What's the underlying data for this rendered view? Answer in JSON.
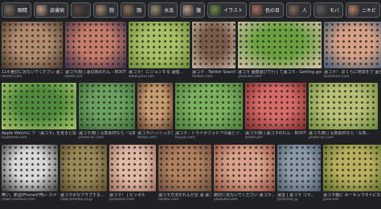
{
  "chips": [
    {
      "label": "眼睛",
      "color": "#7a6a5a"
    },
    {
      "label": "皮膚病",
      "color": "#b99a86"
    },
    {
      "label": "",
      "color": "#5b4a3f"
    },
    {
      "label": "腕",
      "color": "#a08872"
    },
    {
      "label": "顔",
      "color": "#8e6f5c"
    },
    {
      "label": "水虫",
      "color": "#9a8a6a"
    },
    {
      "label": "腹",
      "color": "#b89b8a"
    },
    {
      "label": "イラスト",
      "color": "#6a8a4a"
    },
    {
      "label": "色の目",
      "color": "#aa7060"
    },
    {
      "label": "人",
      "color": "#7b6b5b"
    },
    {
      "label": "モバ",
      "color": "#5a5a5a"
    },
    {
      "label": "ニキビ",
      "color": "#b07f6a"
    },
    {
      "label": "カエル",
      "color": "#6a7a4a"
    }
  ],
  "row1": [
    {
      "caption": "114 絶対に見ないでください 蓮コラ！",
      "source": "twitter.com",
      "colors": [
        "#b28b6f",
        "#4a3a30"
      ]
    },
    {
      "caption": "蓮コラ/顔 | 蓮の顔のれん - BOOTH",
      "source": "booth.pm",
      "colors": [
        "#c77b6b",
        "#3a2c4a"
      ]
    },
    {
      "caption": "蓮コラ！ にジョンする 蓮陸…",
      "source": "www.pixiv.net",
      "colors": [
        "#a8c067",
        "#6d8a3a"
      ]
    },
    {
      "caption": "蓮コラ - Twitter Search…",
      "source": "twitter.com",
      "colors": [
        "#7a5a4a",
        "#c9b8a8"
      ]
    },
    {
      "caption": "蓮コラ 画像遊びで行くて蓮コラ - Getting goos…",
      "source": "youtube.com",
      "colors": [
        "#6aa040",
        "#d9c2b0"
      ]
    },
    {
      "caption": "蓮コラ！ ぼくらに地球をで 蓮がない…",
      "source": "buzzfeed.com",
      "colors": [
        "#d6a086",
        "#3f5a7a"
      ]
    }
  ],
  "row2": [
    {
      "caption": "Apple Watchに ケ「蓮コラ」を見ると思い…",
      "source": "buzzfeed.com",
      "colors": [
        "#4d8a3d",
        "#a8c46a"
      ]
    },
    {
      "caption": "蓮コラ/顔 | 写真素材なら「写真…",
      "source": "photo-ac.com",
      "colors": [
        "#6aa060",
        "#3d6a3a"
      ]
    },
    {
      "caption": "蓮コラ/ハッシュタグな…",
      "source": "tiktok.com",
      "colors": [
        "#c89a72",
        "#5a3a2a"
      ]
    },
    {
      "caption": "蓮コラ - トライポフォビアの蓮とジ…",
      "source": "tsuyoi.com",
      "colors": [
        "#7ab060",
        "#4a7a3a"
      ]
    },
    {
      "caption": "蓮コラ/顔 | 蓮コラのれん - BOOTH",
      "source": "booth.pm",
      "colors": [
        "#d86a6a",
        "#7a2a2a"
      ]
    },
    {
      "caption": "蓮コラ/顔 | 写真素材なら「写真…",
      "source": "photo-ac.com",
      "colors": [
        "#b8c078",
        "#6a8a3a"
      ]
    }
  ],
  "row3": [
    {
      "caption": "無い。新型iPhoneが怖い カメラ…",
      "source": "news.livedoor.com",
      "colors": [
        "#d8d8d8",
        "#3a3a3a"
      ]
    },
    {
      "caption": "蓮コラボなプラプする…",
      "source": "nlab.itmedia.co.jp",
      "colors": [
        "#9a8a5a",
        "#5a4a2a"
      ]
    },
    {
      "caption": "蓮コラ！ | ピッボル",
      "source": "pinterest.com",
      "colors": [
        "#e0b8a8",
        "#9a6a5a"
      ]
    },
    {
      "caption": "蓮コラ方法をれんが企 蓮 蓮コラ…",
      "source": "twitter.com",
      "colors": [
        "#b08060",
        "#6a4a3a"
      ]
    },
    {
      "caption": "絶対に見ないでください 蓮コラ…",
      "source": "youtube.com",
      "colors": [
        "#d8a08a",
        "#8a4a3a"
      ]
    },
    {
      "caption": "蓮虫 | 蓮コラ コラ…",
      "source": "pinterest.jp",
      "colors": [
        "#8a9aa8",
        "#4a5a6a"
      ]
    },
    {
      "caption": "蓮コラ種に みーキュウネトになった",
      "source": "pixiv.net",
      "colors": [
        "#b8b060",
        "#5a6a2a"
      ]
    }
  ]
}
